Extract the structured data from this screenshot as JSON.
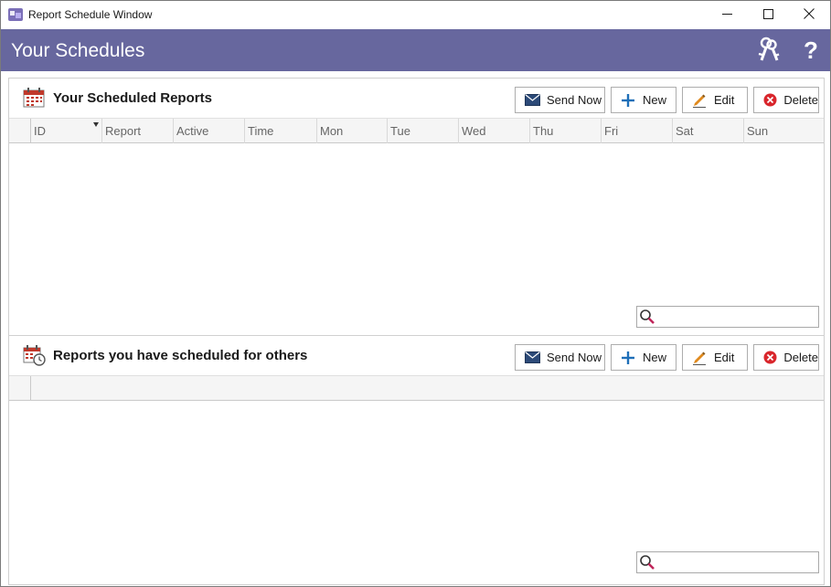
{
  "window": {
    "title": "Report Schedule Window",
    "controls": [
      "minimize-icon",
      "maximize-icon",
      "close-icon"
    ]
  },
  "header": {
    "title": "Your Schedules",
    "background_color": "#67679e",
    "icons": [
      "keys-icon",
      "help-icon"
    ],
    "help_glyph": "?"
  },
  "panels": [
    {
      "title": "Your Scheduled Reports",
      "icon": "calendar-icon",
      "toolbar": {
        "send_now": "Send Now",
        "new": "New",
        "edit": "Edit",
        "delete": "Delete"
      },
      "columns": [
        "ID",
        "Report",
        "Active",
        "Time",
        "Mon",
        "Tue",
        "Wed",
        "Thu",
        "Fri",
        "Sat",
        "Sun"
      ],
      "rows": [],
      "search": {
        "value": "",
        "placeholder": ""
      }
    },
    {
      "title": "Reports you have scheduled for others",
      "icon": "calendar-clock-icon",
      "toolbar": {
        "send_now": "Send Now",
        "new": "New",
        "edit": "Edit",
        "delete": "Delete"
      },
      "columns": [],
      "rows": [],
      "search": {
        "value": "",
        "placeholder": ""
      }
    }
  ],
  "colors": {
    "accent": "#67679e",
    "new_icon": "#1e6fb8",
    "delete_icon": "#d9262c",
    "edit_icon": "#e08a1e",
    "calendar_icon": "#c0392b"
  }
}
